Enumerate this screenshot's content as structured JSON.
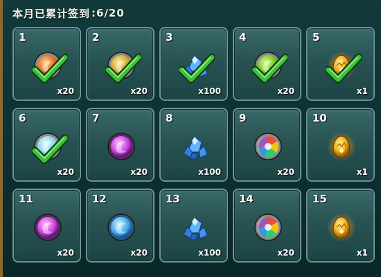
{
  "title": "本月已累计签到",
  "count": ":6/20",
  "days": [
    {
      "day": "1",
      "qty": "x20",
      "icon": "orange-swirl-orb-icon",
      "checked": true
    },
    {
      "day": "2",
      "qty": "x20",
      "icon": "gold-swirl-orb-icon",
      "checked": true
    },
    {
      "day": "3",
      "qty": "x100",
      "icon": "blue-crystal-icon",
      "checked": true
    },
    {
      "day": "4",
      "qty": "x20",
      "icon": "green-swirl-orb-icon",
      "checked": true
    },
    {
      "day": "5",
      "qty": "x1",
      "icon": "gold-egg-icon",
      "checked": true
    },
    {
      "day": "6",
      "qty": "x20",
      "icon": "light-blue-orb-icon",
      "checked": true
    },
    {
      "day": "7",
      "qty": "x20",
      "icon": "purple-swirl-orb-icon",
      "checked": false
    },
    {
      "day": "8",
      "qty": "x100",
      "icon": "blue-crystal-icon",
      "checked": false
    },
    {
      "day": "9",
      "qty": "x20",
      "icon": "rainbow-swirl-orb-icon",
      "checked": false
    },
    {
      "day": "10",
      "qty": "x1",
      "icon": "gold-egg-icon",
      "checked": false
    },
    {
      "day": "11",
      "qty": "x20",
      "icon": "purple-swirl-orb-icon",
      "checked": false
    },
    {
      "day": "12",
      "qty": "x20",
      "icon": "blue-swirl-orb-icon",
      "checked": false
    },
    {
      "day": "13",
      "qty": "x100",
      "icon": "blue-crystal-icon",
      "checked": false
    },
    {
      "day": "14",
      "qty": "x20",
      "icon": "rainbow-swirl-orb-icon",
      "checked": false
    },
    {
      "day": "15",
      "qty": "x1",
      "icon": "gold-egg-icon",
      "checked": false
    }
  ],
  "colors": {
    "check": "#39c23a",
    "cell_border": "#6f9497",
    "frame_accent": "#8a6a2e"
  }
}
